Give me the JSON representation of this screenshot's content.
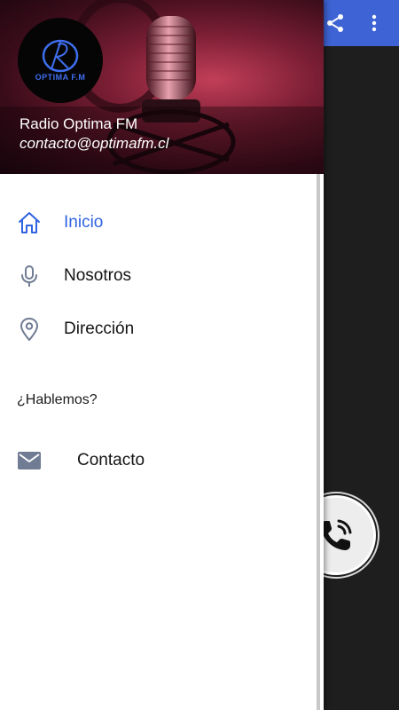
{
  "app": {
    "toolbar": {
      "share_icon": "share-icon",
      "more_icon": "more-vert-icon",
      "bar_color": "#3d63d4"
    },
    "fab": {
      "icon": "phone-call-icon"
    }
  },
  "drawer": {
    "header": {
      "logo_text": "OPTIMA F.M",
      "title": "Radio Optima FM",
      "email": "contacto@optimafm.cl"
    },
    "items": [
      {
        "label": "Inicio",
        "icon": "home-icon",
        "active": true
      },
      {
        "label": "Nosotros",
        "icon": "microphone-icon",
        "active": false
      },
      {
        "label": "Dirección",
        "icon": "location-pin-icon",
        "active": false
      }
    ],
    "section_header": "¿Hablemos?",
    "contact": {
      "label": "Contacto",
      "icon": "mail-icon"
    },
    "accent_color": "#2f63e0"
  }
}
